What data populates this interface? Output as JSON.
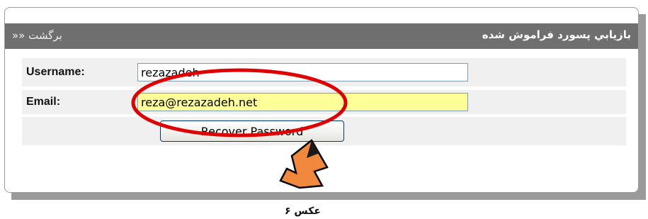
{
  "header": {
    "back_label": "»» برگشت",
    "title": "بازيابي پسورد فراموش شده"
  },
  "form": {
    "username_label": "Username:",
    "username_value": "rezazadeh",
    "email_label": "Email:",
    "email_value": "reza@rezazadeh.net",
    "recover_button": "Recover Password"
  },
  "caption": "عکس ۶",
  "colors": {
    "titlebar": "#6f6f6f",
    "highlight_ellipse": "#e00000",
    "cursor_fill": "#f0893e",
    "email_bg": "#ffff99"
  },
  "icons": {
    "cursor": "hand-pointer-icon"
  }
}
